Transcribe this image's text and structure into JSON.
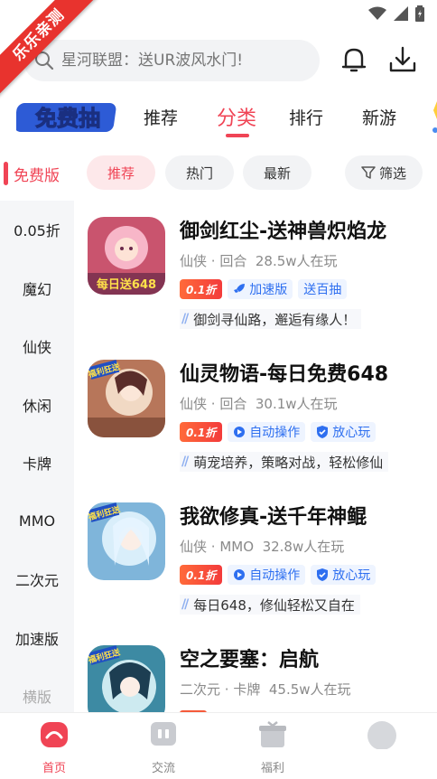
{
  "ribbon": "乐乐亲测",
  "search": {
    "placeholder": "星河联盟：送UR波风水门!"
  },
  "header": {
    "free_logo": "免费抽"
  },
  "tabs": [
    {
      "label": "推荐"
    },
    {
      "label": "分类"
    },
    {
      "label": "排行"
    },
    {
      "label": "新游"
    }
  ],
  "sidebar": {
    "heading": "免费版",
    "items": [
      {
        "label": "0.05折"
      },
      {
        "label": "魔幻"
      },
      {
        "label": "仙侠"
      },
      {
        "label": "休闲"
      },
      {
        "label": "卡牌"
      },
      {
        "label": "MMO"
      },
      {
        "label": "二次元"
      },
      {
        "label": "加速版"
      },
      {
        "label": "横版"
      }
    ]
  },
  "filters": [
    {
      "label": "推荐"
    },
    {
      "label": "热门"
    },
    {
      "label": "最新"
    },
    {
      "label": "筛选"
    }
  ],
  "games": [
    {
      "title": "御剑红尘-送神兽炽焰龙",
      "genre": "仙侠",
      "mode": "回合",
      "players": "28.5w人在玩",
      "discount": "0.1折",
      "tags": [
        {
          "icon": "rocket-icon",
          "label": "加速版"
        },
        {
          "icon": "",
          "label": "送百抽"
        }
      ],
      "desc": "御剑寻仙路，邂逅有缘人！",
      "thumb_text": "每日送648",
      "colors": [
        "#f7b6c8",
        "#c9546e",
        "#6b2a4a"
      ]
    },
    {
      "title": "仙灵物语-每日免费648",
      "genre": "仙侠",
      "mode": "回合",
      "players": "30.1w人在玩",
      "discount": "0.1折",
      "tags": [
        {
          "icon": "auto-icon",
          "label": "自动操作"
        },
        {
          "icon": "shield-icon",
          "label": "放心玩"
        }
      ],
      "desc": "萌宠培养，策略对战，轻松修仙",
      "thumb_text": "福利狂送",
      "colors": [
        "#f1d9c4",
        "#b7765a",
        "#5a2d2a"
      ]
    },
    {
      "title": "我欲修真-送千年神鲲",
      "genre": "仙侠",
      "mode": "MMO",
      "players": "32.8w人在玩",
      "discount": "0.1折",
      "tags": [
        {
          "icon": "auto-icon",
          "label": "自动操作"
        },
        {
          "icon": "shield-icon",
          "label": "放心玩"
        }
      ],
      "desc": "每日648，修仙轻松又自在",
      "thumb_text": "福利狂送",
      "colors": [
        "#d9eefa",
        "#7fb5da",
        "#345f88"
      ]
    },
    {
      "title": "空之要塞：启航",
      "genre": "二次元",
      "mode": "卡牌",
      "players": "45.5w人在玩",
      "discount": "",
      "tags": [],
      "desc": "",
      "thumb_text": "福利狂送",
      "colors": [
        "#cdeaf0",
        "#3d8aa3",
        "#1d3e52"
      ]
    }
  ],
  "bottom_nav": [
    {
      "label": "首页"
    },
    {
      "label": "交流"
    },
    {
      "label": "福利"
    },
    {
      "label": ""
    }
  ],
  "accent": "#f04455"
}
